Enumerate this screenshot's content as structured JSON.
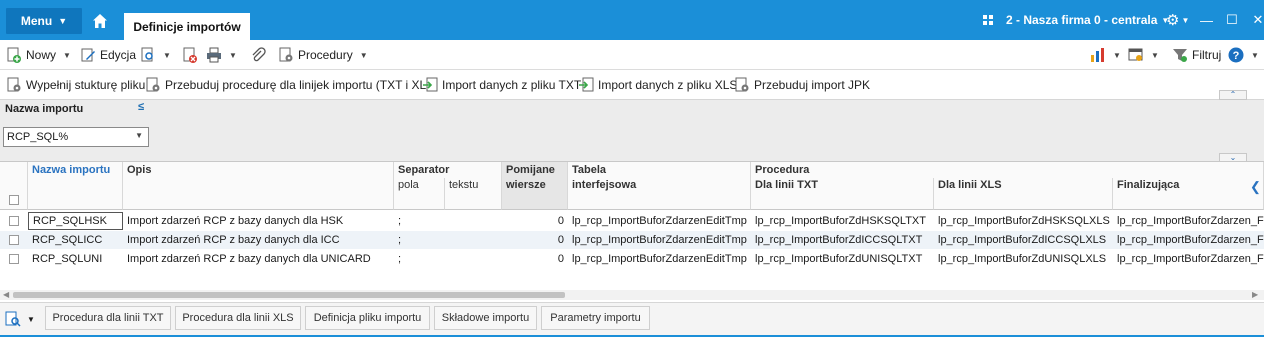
{
  "titlebar": {
    "menu_label": "Menu",
    "active_tab": "Definicje importów",
    "company": "2 - Nasza firma 0 - centrala"
  },
  "toolbar1": {
    "new_label": "Nowy",
    "edit_label": "Edycja",
    "procedures_label": "Procedury",
    "filter_label": "Filtruj"
  },
  "toolbar2": {
    "actions": [
      "Wypełnij stukturę pliku",
      "Przebuduj procedurę dla linijek importu (TXT i XLS)",
      "Import danych z pliku TXT",
      "Import danych z pliku XLS",
      "Przebuduj import JPK"
    ]
  },
  "filter": {
    "label": "Nazwa importu",
    "eq_symbol": "≤",
    "value": "RCP_SQL%"
  },
  "grid": {
    "headers": {
      "nazwa": "Nazwa importu",
      "opis": "Opis",
      "separator": "Separator",
      "pola": "pola",
      "tekstu": "tekstu",
      "pomijane": "Pomijane",
      "wiersze": "wiersze",
      "tabela": "Tabela",
      "interfejsowa": "interfejsowa",
      "procedura": "Procedura",
      "dla_txt": "Dla linii TXT",
      "dla_xls": "Dla linii XLS",
      "finalizujaca": "Finalizująca"
    },
    "rows": [
      {
        "nazwa": "RCP_SQLHSK",
        "opis": "Import zdarzeń RCP z bazy danych dla HSK",
        "pola": ";",
        "tekstu": "",
        "pomijane": "0",
        "tabela": "lp_rcp_ImportBuforZdarzenEditTmp",
        "txt": "lp_rcp_ImportBuforZdHSKSQLTXT",
        "xls": "lp_rcp_ImportBuforZdHSKSQLXLS",
        "fin": "lp_rcp_ImportBuforZdarzen_F"
      },
      {
        "nazwa": "RCP_SQLICC",
        "opis": "Import zdarzeń RCP z bazy danych dla ICC",
        "pola": ";",
        "tekstu": "",
        "pomijane": "0",
        "tabela": "lp_rcp_ImportBuforZdarzenEditTmp",
        "txt": "lp_rcp_ImportBuforZdICCSQLTXT",
        "xls": "lp_rcp_ImportBuforZdICCSQLXLS",
        "fin": "lp_rcp_ImportBuforZdarzen_F"
      },
      {
        "nazwa": "RCP_SQLUNI",
        "opis": "Import zdarzeń RCP z bazy danych dla UNICARD",
        "pola": ";",
        "tekstu": "",
        "pomijane": "0",
        "tabela": "lp_rcp_ImportBuforZdarzenEditTmp",
        "txt": "lp_rcp_ImportBuforZdUNISQLTXT",
        "xls": "lp_rcp_ImportBuforZdUNISQLXLS",
        "fin": "lp_rcp_ImportBuforZdarzen_F"
      }
    ]
  },
  "bottom_tabs": [
    "Procedura dla linii TXT",
    "Procedura dla linii XLS",
    "Definicja pliku importu",
    "Składowe importu",
    "Parametry importu"
  ],
  "colors": {
    "titlebar": "#1b8fd8",
    "accent_blue": "#2a73c0",
    "row_alt": "#eef3f8"
  }
}
